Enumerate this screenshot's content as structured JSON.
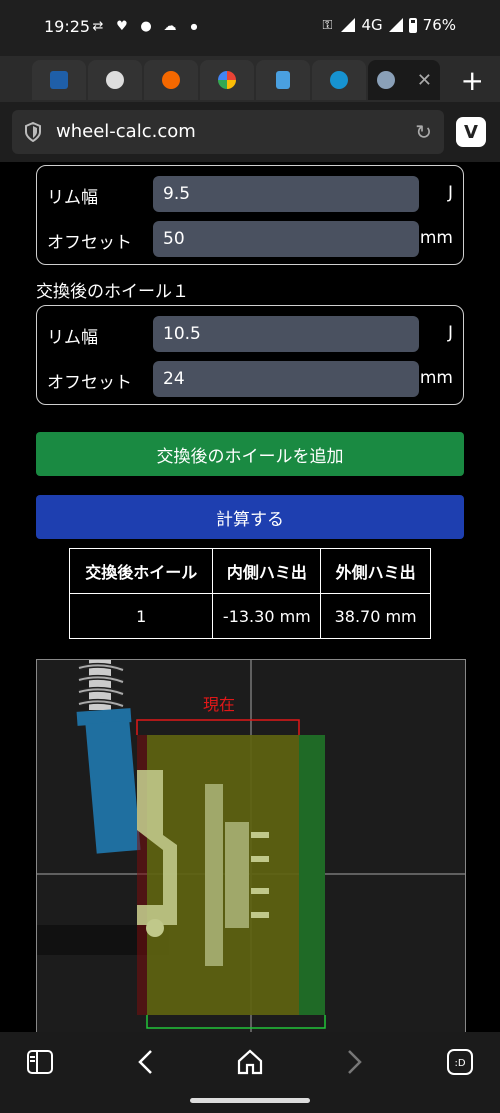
{
  "status": {
    "time": "19:25",
    "network": "4G",
    "battery": "76%"
  },
  "browser": {
    "url": "wheel-calc.com"
  },
  "current_wheel": {
    "rim_label": "リム幅",
    "rim_value": "9.5",
    "rim_unit": "J",
    "offset_label": "オフセット",
    "offset_value": "50",
    "offset_unit": "mm"
  },
  "new_wheel_1": {
    "title": "交換後のホイール１",
    "rim_label": "リム幅",
    "rim_value": "10.5",
    "rim_unit": "J",
    "offset_label": "オフセット",
    "offset_value": "24",
    "offset_unit": "mm"
  },
  "buttons": {
    "add_wheel": "交換後のホイールを追加",
    "calculate": "計算する"
  },
  "results": {
    "headers": [
      "交換後ホイール",
      "内側ハミ出",
      "外側ハミ出"
    ],
    "rows": [
      {
        "wheel": "1",
        "inner": "-13.30 mm",
        "outer": "38.70 mm"
      }
    ]
  },
  "diagram": {
    "current_label": "現在"
  },
  "colors": {
    "green_button": "#1a8a42",
    "blue_button": "#1e3fb0",
    "current_outline": "#e01818",
    "new_outline": "#22c43a"
  }
}
